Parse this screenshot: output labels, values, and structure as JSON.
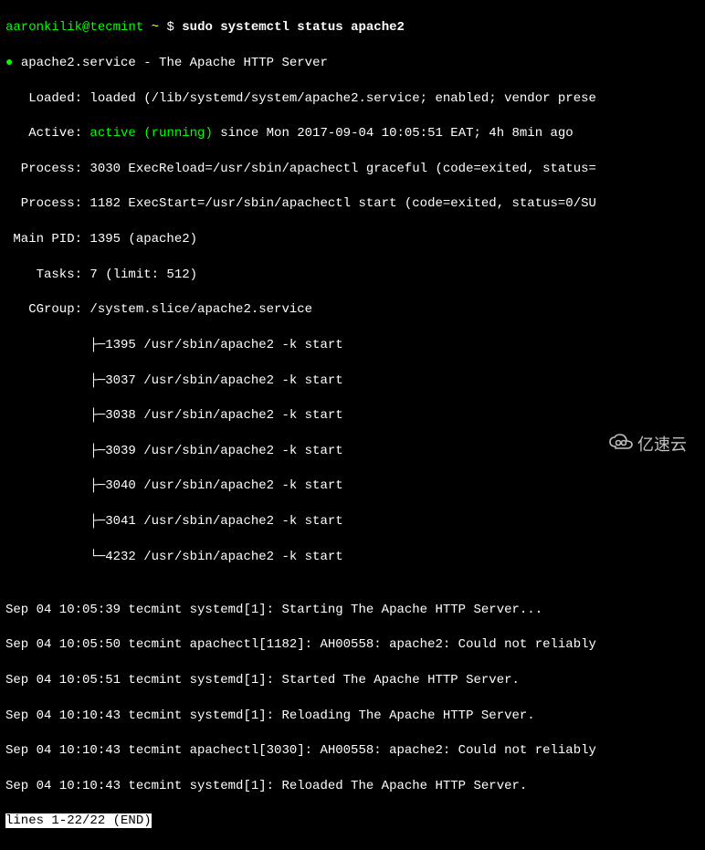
{
  "prompt": {
    "user": "aaronkilik@tecmint",
    "path": "~",
    "symbol": "$",
    "command": "sudo systemctl status apache2"
  },
  "status": {
    "bullet": "●",
    "service_name": "apache2.service",
    "description": " - The Apache HTTP Server",
    "loaded_label": "   Loaded: ",
    "loaded_value": "loaded (/lib/systemd/system/apache2.service; enabled; vendor prese",
    "active_label": "   Active: ",
    "active_state": "active (running)",
    "active_since": " since Mon 2017-09-04 10:05:51 EAT; 4h 8min ago",
    "process1": "  Process: 3030 ExecReload=/usr/sbin/apachectl graceful (code=exited, status=",
    "process2": "  Process: 1182 ExecStart=/usr/sbin/apachectl start (code=exited, status=0/SU",
    "main_pid": " Main PID: 1395 (apache2)",
    "tasks": "    Tasks: 7 (limit: 512)",
    "cgroup_label": "   CGroup: ",
    "cgroup_path": "/system.slice/apache2.service",
    "tree": [
      "           ├─1395 /usr/sbin/apache2 -k start",
      "           ├─3037 /usr/sbin/apache2 -k start",
      "           ├─3038 /usr/sbin/apache2 -k start",
      "           ├─3039 /usr/sbin/apache2 -k start",
      "           ├─3040 /usr/sbin/apache2 -k start",
      "           ├─3041 /usr/sbin/apache2 -k start",
      "           └─4232 /usr/sbin/apache2 -k start"
    ],
    "blank": "",
    "logs": [
      "Sep 04 10:05:39 tecmint systemd[1]: Starting The Apache HTTP Server...",
      "Sep 04 10:05:50 tecmint apachectl[1182]: AH00558: apache2: Could not reliably",
      "Sep 04 10:05:51 tecmint systemd[1]: Started The Apache HTTP Server.",
      "Sep 04 10:10:43 tecmint systemd[1]: Reloading The Apache HTTP Server.",
      "Sep 04 10:10:43 tecmint apachectl[3030]: AH00558: apache2: Could not reliably",
      "Sep 04 10:10:43 tecmint systemd[1]: Reloaded The Apache HTTP Server."
    ],
    "pager": "lines 1-22/22 (END)"
  },
  "watermark": "亿速云"
}
